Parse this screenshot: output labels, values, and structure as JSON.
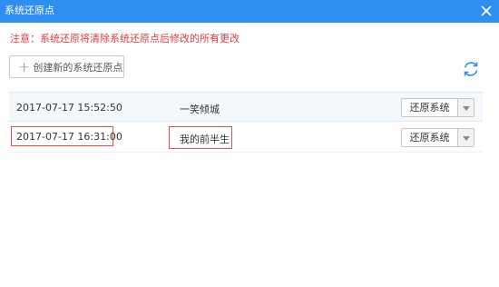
{
  "window": {
    "title": "系统还原点"
  },
  "warning": "注意：系统还原将清除系统还原点后修改的所有更改",
  "toolbar": {
    "create_label": "创建新的系统还原点"
  },
  "restore_points": [
    {
      "time": "2017-07-17 15:52:50",
      "name": "一笑倾城",
      "button": "还原系统"
    },
    {
      "time": "2017-07-17 16:31:00",
      "name": "我的前半生",
      "button": "还原系统"
    }
  ],
  "colors": {
    "titlebar": "#2f8ff1",
    "warning_text": "#e8383d",
    "highlight_box": "#e45050",
    "refresh_icon": "#2f8ff1"
  }
}
